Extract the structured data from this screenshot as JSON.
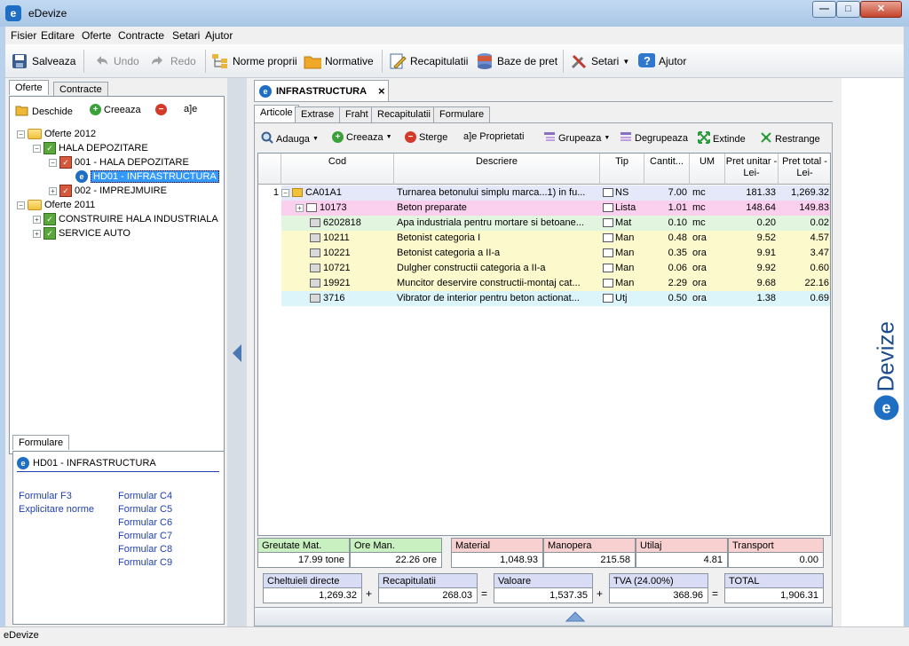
{
  "window": {
    "title": "eDevize",
    "icon": "e-logo-icon",
    "min": "—",
    "max": "□",
    "close": "✕"
  },
  "menu": [
    "Fisier",
    "Editare",
    "Oferte",
    "Contracte",
    "Setari",
    "Ajutor"
  ],
  "toolbar": {
    "save": "Salveaza",
    "undo": "Undo",
    "redo": "Redo",
    "norme": "Norme proprii",
    "normative": "Normative",
    "recap": "Recapitulatii",
    "baze": "Baze de pret",
    "setari": "Setari",
    "ajutor": "Ajutor"
  },
  "left": {
    "tabs": [
      "Oferte",
      "Contracte"
    ],
    "actions": {
      "open": "Deschide",
      "create": "Creeaza",
      "rename": "a]e"
    },
    "tree": [
      {
        "label": "Oferte 2012",
        "level": 0,
        "icon": "folder",
        "exp": "−"
      },
      {
        "label": "HALA DEPOZITARE",
        "level": 1,
        "icon": "green",
        "exp": "−"
      },
      {
        "label": "001 - HALA DEPOZITARE",
        "level": 2,
        "icon": "red",
        "exp": "−"
      },
      {
        "label": "HD01 - INFRASTRUCTURA",
        "level": 3,
        "icon": "e",
        "exp": "",
        "selected": true
      },
      {
        "label": "002 - IMPREJMUIRE",
        "level": 2,
        "icon": "red",
        "exp": "+"
      },
      {
        "label": "Oferte 2011",
        "level": 0,
        "icon": "folder",
        "exp": "−"
      },
      {
        "label": "CONSTRUIRE HALA INDUSTRIALA",
        "level": 1,
        "icon": "green",
        "exp": "+"
      },
      {
        "label": "SERVICE AUTO",
        "level": 1,
        "icon": "green",
        "exp": "+"
      }
    ],
    "formulare": {
      "tab": "Formulare",
      "title": "HD01 - INFRASTRUCTURA",
      "col1": [
        "Formular F3",
        "Explicitare norme"
      ],
      "col2": [
        "Formular C4",
        "Formular C5",
        "Formular C6",
        "Formular C7",
        "Formular C8",
        "Formular C9"
      ]
    }
  },
  "main": {
    "doc_tab": "INFRASTRUCTURA",
    "doc_close": "×",
    "subtabs": [
      "Articole",
      "Extrase",
      "Fraht",
      "Recapitulatii",
      "Formulare"
    ],
    "actions": [
      "Adauga",
      "Creeaza",
      "Sterge",
      "Proprietati",
      "Grupeaza",
      "Degrupeaza",
      "Extinde",
      "Restrange"
    ],
    "rename_glyph": "a]e",
    "columns": [
      "Cod",
      "Descriere",
      "Tip",
      "Cantit...",
      "UM",
      "Pret unitar -Lei-",
      "Pret total -Lei-"
    ],
    "rows": [
      {
        "nr": "1",
        "exp": "−",
        "icon": "folder",
        "cod": "CA01A1",
        "desc": "Turnarea betonului simplu marca...1) in fu...",
        "tip": "NS",
        "qty": "7.00",
        "um": "mc",
        "pu": "181.33",
        "pt": "1,269.32",
        "bg": "#e4e8f8"
      },
      {
        "nr": "",
        "exp": "+",
        "icon": "list",
        "cod": "10173",
        "desc": "Beton preparate",
        "tip": "Lista",
        "qty": "1.01",
        "um": "mc",
        "pu": "148.64",
        "pt": "149.83",
        "bg": "#fbd0ee"
      },
      {
        "nr": "",
        "exp": "",
        "icon": "res",
        "cod": "6202818",
        "desc": "Apa industriala pentru mortare si betoane...",
        "tip": "Mat",
        "qty": "0.10",
        "um": "mc",
        "pu": "0.20",
        "pt": "0.02",
        "bg": "#e2f5df"
      },
      {
        "nr": "",
        "exp": "",
        "icon": "res",
        "cod": "10211",
        "desc": "Betonist categoria I",
        "tip": "Man",
        "qty": "0.48",
        "um": "ora",
        "pu": "9.52",
        "pt": "4.57",
        "bg": "#fcfacd"
      },
      {
        "nr": "",
        "exp": "",
        "icon": "res",
        "cod": "10221",
        "desc": "Betonist categoria a II-a",
        "tip": "Man",
        "qty": "0.35",
        "um": "ora",
        "pu": "9.91",
        "pt": "3.47",
        "bg": "#fcfacd"
      },
      {
        "nr": "",
        "exp": "",
        "icon": "res",
        "cod": "10721",
        "desc": "Dulgher constructii categoria a II-a",
        "tip": "Man",
        "qty": "0.06",
        "um": "ora",
        "pu": "9.92",
        "pt": "0.60",
        "bg": "#fcfacd"
      },
      {
        "nr": "",
        "exp": "",
        "icon": "res",
        "cod": "19921",
        "desc": "Muncitor deservire constructii-montaj cat...",
        "tip": "Man",
        "qty": "2.29",
        "um": "ora",
        "pu": "9.68",
        "pt": "22.16",
        "bg": "#fcfacd"
      },
      {
        "nr": "",
        "exp": "",
        "icon": "res",
        "cod": "3716",
        "desc": "Vibrator de interior pentru beton actionat...",
        "tip": "Utj",
        "qty": "0.50",
        "um": "ora",
        "pu": "1.38",
        "pt": "0.69",
        "bg": "#dcf5fa"
      }
    ],
    "totals_row1": [
      {
        "label": "Greutate Mat.",
        "value": "17.99 tone",
        "color": "#c8f0c0"
      },
      {
        "label": "Ore Man.",
        "value": "22.26 ore",
        "color": "#c8f0c0"
      },
      {
        "label": "Material",
        "value": "1,048.93",
        "color": "#f8d0d0"
      },
      {
        "label": "Manopera",
        "value": "215.58",
        "color": "#f8d0d0"
      },
      {
        "label": "Utilaj",
        "value": "4.81",
        "color": "#f8d0d0"
      },
      {
        "label": "Transport",
        "value": "0.00",
        "color": "#f8d0d0"
      }
    ],
    "totals_row2": [
      {
        "label": "Cheltuieli directe",
        "value": "1,269.32"
      },
      {
        "label": "Recapitulatii",
        "value": "268.03"
      },
      {
        "label": "Valoare",
        "value": "1,537.35"
      },
      {
        "label": "TVA (24.00%)",
        "value": "368.96"
      },
      {
        "label": "TOTAL",
        "value": "1,906.31"
      }
    ],
    "ops": [
      "+",
      "=",
      "+",
      "="
    ]
  },
  "banner": {
    "brand": "Devize",
    "icon": "e-logo-icon"
  },
  "status": "eDevize",
  "colors": {
    "accent": "#1e6fc4",
    "selection": "#3399ff"
  }
}
